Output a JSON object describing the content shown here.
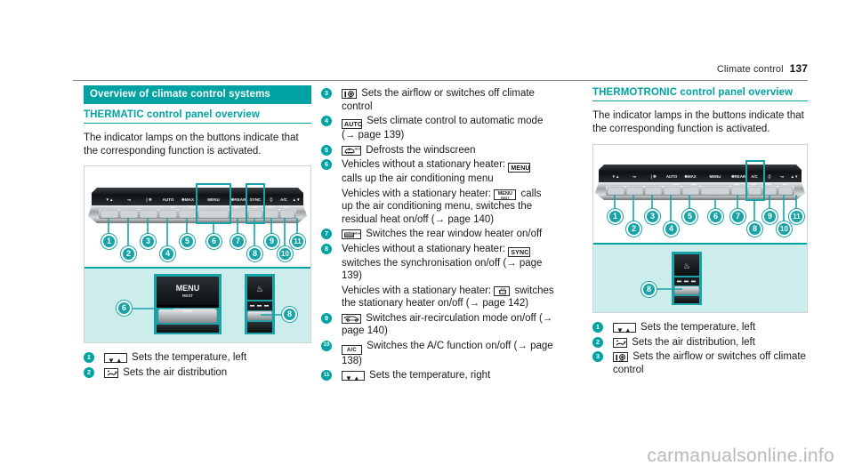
{
  "header": {
    "chapter": "Climate control",
    "page_number": "137"
  },
  "colors": {
    "teal": "#00a3a3",
    "teal_light": "#cdecec",
    "callout": "#17a3a8"
  },
  "left_column": {
    "band_heading": "Overview of climate control systems",
    "sub_heading": "THERMATIC control panel overview",
    "intro": "The indicator lamps on the buttons indicate that the corresponding function is activated.",
    "figure": {
      "name": "thermatic-control-panel",
      "callouts_upper": [
        "1",
        "2",
        "3",
        "4",
        "5",
        "6",
        "7",
        "8",
        "9",
        "10",
        "11"
      ],
      "callouts_lower": [
        "6",
        "8"
      ],
      "button_labels": [
        "MENU",
        "REST"
      ],
      "detail_labels": [
        "MENU",
        "REST"
      ]
    },
    "items": [
      {
        "num": "1",
        "icon": "temperature-arrows-icon",
        "icon_text": "▼▲",
        "text": "Sets the temperature, left"
      },
      {
        "num": "2",
        "icon": "air-distribution-icon",
        "icon_text": "",
        "text": "Sets the air distribution"
      }
    ]
  },
  "middle_column": {
    "items": [
      {
        "num": "3",
        "icon": "airflow-off-icon",
        "text": "Sets the airflow or switches off climate control"
      },
      {
        "num": "4",
        "icon": "auto-icon",
        "icon_text": "AUTO",
        "text": "Sets climate control to automatic mode (→ page 139)"
      },
      {
        "num": "5",
        "icon": "defrost-windscreen-max-icon",
        "icon_text": "MAX",
        "text": "Defrosts the windscreen"
      },
      {
        "num": "6",
        "icon": "menu-icon",
        "icon_text": "MENU",
        "text_before": "Vehicles without a stationary heater:",
        "text_after": "calls up the air conditioning menu",
        "sub_icon": "menu-rest-icon",
        "sub_icon_text": "MENU",
        "sub_icon_text2": "REST",
        "sub_before": "Vehicles with a stationary heater:",
        "sub_after": "calls up the air conditioning menu, switches the residual heat on/off (→ page 140)"
      },
      {
        "num": "7",
        "icon": "rear-window-heater-icon",
        "icon_text": "REAR",
        "text": "Switches the rear window heater on/off"
      },
      {
        "num": "8",
        "icon": "sync-icon",
        "icon_text": "SYNC",
        "text_before": "Vehicles without a stationary heater:",
        "text_after": "switches the synchronisation on/off (→ page 139)",
        "sub_icon": "stationary-heater-icon",
        "sub_before": "Vehicles with a stationary heater:",
        "sub_after": "switches the stationary heater on/off (→ page 142)"
      },
      {
        "num": "9",
        "icon": "air-recirculation-icon",
        "text": "Switches air-recirculation mode on/off (→ page 140)"
      },
      {
        "num": "10",
        "icon": "ac-icon",
        "icon_text": "A/C",
        "text": "Switches the A/C function on/off (→ page 138)"
      },
      {
        "num": "11",
        "icon": "temperature-arrows-icon",
        "icon_text": "▼▲",
        "text": "Sets the temperature, right"
      }
    ]
  },
  "right_column": {
    "sub_heading": "THERMOTRONIC control panel overview",
    "intro": "The indicator lamps in the buttons indicate that the corresponding function is activated.",
    "figure": {
      "name": "thermotronic-control-panel",
      "callouts_upper": [
        "1",
        "2",
        "3",
        "4",
        "5",
        "6",
        "7",
        "8",
        "9",
        "10",
        "11"
      ],
      "callouts_lower": [
        "8"
      ]
    },
    "items": [
      {
        "num": "1",
        "icon": "temperature-arrows-icon",
        "icon_text": "▼▲",
        "text": "Sets the temperature, left"
      },
      {
        "num": "2",
        "icon": "air-distribution-icon",
        "text": "Sets the air distribution, left"
      },
      {
        "num": "3",
        "icon": "airflow-off-icon",
        "text": "Sets the airflow or switches off climate control"
      }
    ]
  },
  "watermark": "carmanualsonline.info"
}
